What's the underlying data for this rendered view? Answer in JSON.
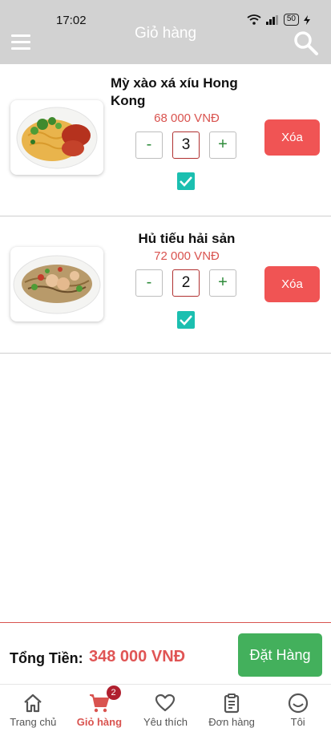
{
  "status_bar": {
    "time": "17:02",
    "battery": "50"
  },
  "header": {
    "title": "Giỏ hàng"
  },
  "cart": {
    "items": [
      {
        "name": "Mỳ xào xá xíu Hong Kong",
        "price": "68 000 VNĐ",
        "quantity": "3",
        "minus_label": "-",
        "plus_label": "+",
        "checked": true,
        "delete_label": "Xóa"
      },
      {
        "name": "Hủ tiếu hải sản",
        "price": "72 000 VNĐ",
        "quantity": "2",
        "minus_label": "-",
        "plus_label": "+",
        "checked": true,
        "delete_label": "Xóa"
      }
    ]
  },
  "summary": {
    "total_label": "Tổng Tiền:",
    "total_value": "348 000 VNĐ",
    "order_button": "Đặt Hàng"
  },
  "bottom_nav": {
    "items": [
      {
        "label": "Trang chủ",
        "icon": "home-icon"
      },
      {
        "label": "Giỏ hàng",
        "icon": "cart-icon",
        "badge": "2",
        "active": true
      },
      {
        "label": "Yêu thích",
        "icon": "heart-icon"
      },
      {
        "label": "Đơn hàng",
        "icon": "clipboard-icon"
      },
      {
        "label": "Tôi",
        "icon": "profile-icon"
      }
    ]
  },
  "colors": {
    "header_bg": "#d2d2d2",
    "accent_red": "#d9534f",
    "delete_bg": "#f05454",
    "order_green": "#43b05c",
    "checkbox_teal": "#1bbfb0"
  }
}
